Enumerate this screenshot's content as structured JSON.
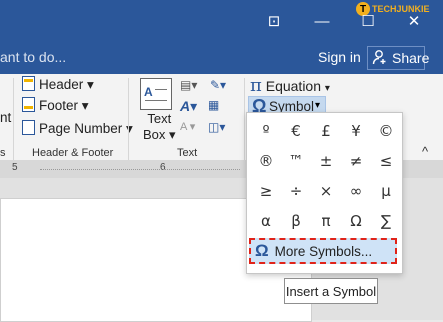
{
  "titlebar": {
    "logo_text": "TECHJUNKIE",
    "buttons": [
      "⊡",
      "—",
      "☐",
      "✕"
    ]
  },
  "tellbar": {
    "tell_me_text": "ant to do...",
    "sign_in": "Sign in",
    "share": "Share"
  },
  "ribbon": {
    "left_partial": "nt",
    "left_partial_group": "s",
    "header": "Header ▾",
    "footer": "Footer ▾",
    "page_number": "Page Number ▾",
    "group_header_footer": "Header & Footer",
    "text_box_line1": "Text",
    "text_box_line2": "Box ▾",
    "group_text": "Text",
    "equation": "Equation",
    "symbol": "Symbol",
    "collapse": "^"
  },
  "ruler": {
    "numbers": [
      "5",
      "6"
    ]
  },
  "symbols": {
    "rows": [
      [
        "º",
        "€",
        "£",
        "¥",
        "©"
      ],
      [
        "®",
        "™",
        "±",
        "≠",
        "≤"
      ],
      [
        "≥",
        "÷",
        "×",
        "∞",
        "µ"
      ],
      [
        "α",
        "β",
        "π",
        "Ω",
        "∑"
      ]
    ],
    "more_symbols": "More Symbols...",
    "more_symbols_icon": "Ω"
  },
  "tooltip": {
    "text": "Insert a Symbol"
  }
}
